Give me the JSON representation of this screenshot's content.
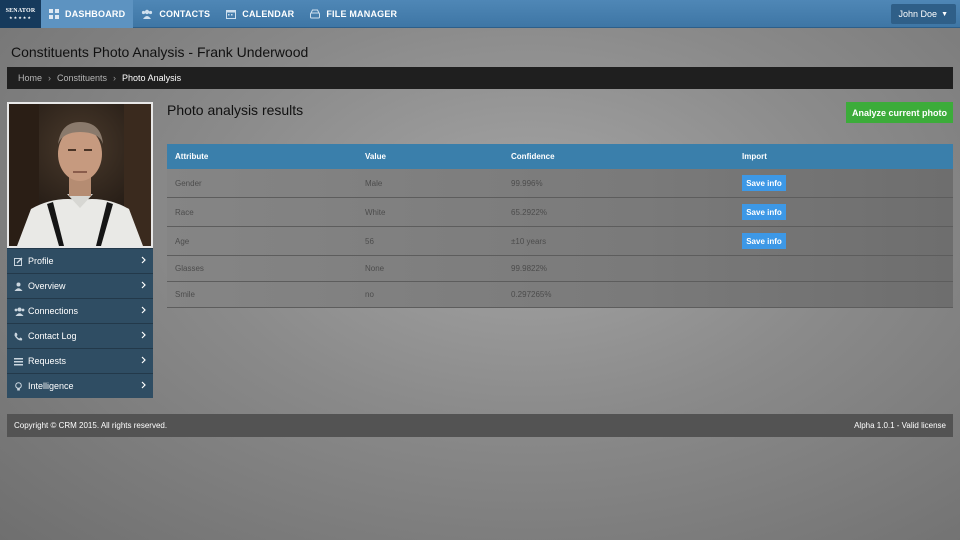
{
  "nav": {
    "logo_text": "SENATOR",
    "items": [
      {
        "label": "DASHBOARD",
        "icon": "grid-icon",
        "active": true
      },
      {
        "label": "CONTACTS",
        "icon": "users-icon",
        "active": false
      },
      {
        "label": "CALENDAR",
        "icon": "calendar-icon",
        "active": false
      },
      {
        "label": "FILE MANAGER",
        "icon": "drive-icon",
        "active": false
      }
    ],
    "user": "John Doe"
  },
  "page_title": "Constituents Photo Analysis - Frank Underwood",
  "breadcrumb": [
    "Home",
    "Constituents",
    "Photo Analysis"
  ],
  "sidebar": {
    "items": [
      {
        "label": "Profile",
        "icon": "edit-icon"
      },
      {
        "label": "Overview",
        "icon": "user-icon"
      },
      {
        "label": "Connections",
        "icon": "users-icon"
      },
      {
        "label": "Contact Log",
        "icon": "phone-icon"
      },
      {
        "label": "Requests",
        "icon": "list-icon"
      },
      {
        "label": "Intelligence",
        "icon": "lightbulb-icon"
      }
    ]
  },
  "main": {
    "title": "Photo analysis results",
    "analyze_label": "Analyze current photo",
    "columns": [
      "Attribute",
      "Value",
      "Confidence",
      "Import"
    ],
    "rows": [
      {
        "attribute": "Gender",
        "value": "Male",
        "confidence": "99.996%",
        "import": "Save info"
      },
      {
        "attribute": "Race",
        "value": "White",
        "confidence": "65.2922%",
        "import": "Save info"
      },
      {
        "attribute": "Age",
        "value": "56",
        "confidence": "±10 years",
        "import": "Save info"
      },
      {
        "attribute": "Glasses",
        "value": "None",
        "confidence": "99.9822%",
        "import": ""
      },
      {
        "attribute": "Smile",
        "value": "no",
        "confidence": "0.297265%",
        "import": ""
      }
    ]
  },
  "footer": {
    "copyright": "Copyright © CRM 2015. All rights reserved.",
    "version": "Alpha 1.0.1 - Valid license"
  },
  "colors": {
    "nav": "#4a82b1",
    "logo": "#163a5c",
    "sidebar": "#2f4d63",
    "table_header": "#3a7fab",
    "analyze": "#3cac3a",
    "save": "#3d98e6"
  }
}
